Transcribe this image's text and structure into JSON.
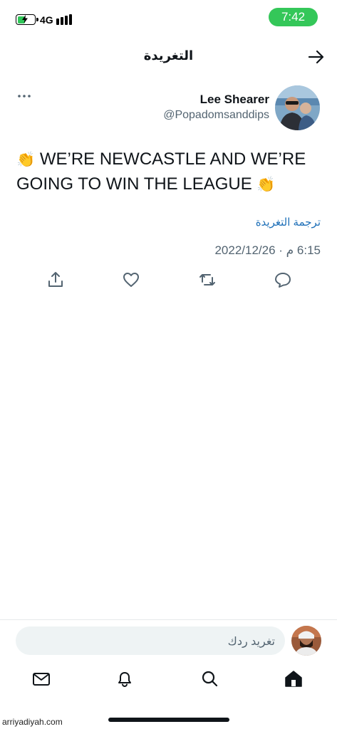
{
  "status_bar": {
    "time": "7:42",
    "network": "4G",
    "battery_level": 0.45,
    "battery_charging": true,
    "clock_pill_color": "#34c759"
  },
  "header": {
    "title": "التغريدة",
    "back_icon": "arrow-right-icon"
  },
  "tweet": {
    "author_name": "Lee Shearer",
    "author_handle": "@Popadomsanddips",
    "text_line_1": " WE’RE NEWCASTLE AND WE’RE",
    "text_line_2": "GOING TO WIN THE LEAGUE ",
    "emoji": "👏",
    "translate_label": "ترجمة التغريدة",
    "timestamp": "6:15 م · 2022/12/26",
    "more_icon": "more-horizontal-icon"
  },
  "actions": [
    {
      "name": "share",
      "icon": "share-icon"
    },
    {
      "name": "like",
      "icon": "heart-icon"
    },
    {
      "name": "retweet",
      "icon": "retweet-icon"
    },
    {
      "name": "reply",
      "icon": "reply-icon"
    }
  ],
  "reply_bar": {
    "placeholder": "تغريد ردك"
  },
  "tab_bar": [
    {
      "name": "messages",
      "icon": "mail-icon"
    },
    {
      "name": "notifications",
      "icon": "bell-icon"
    },
    {
      "name": "search",
      "icon": "search-icon"
    },
    {
      "name": "home",
      "icon": "home-icon",
      "active": true
    }
  ],
  "watermark": "arriyadiyah.com",
  "colors": {
    "text_primary": "#0f1419",
    "text_secondary": "#536471",
    "link": "#1d6fb8",
    "input_bg": "#eef3f4"
  }
}
